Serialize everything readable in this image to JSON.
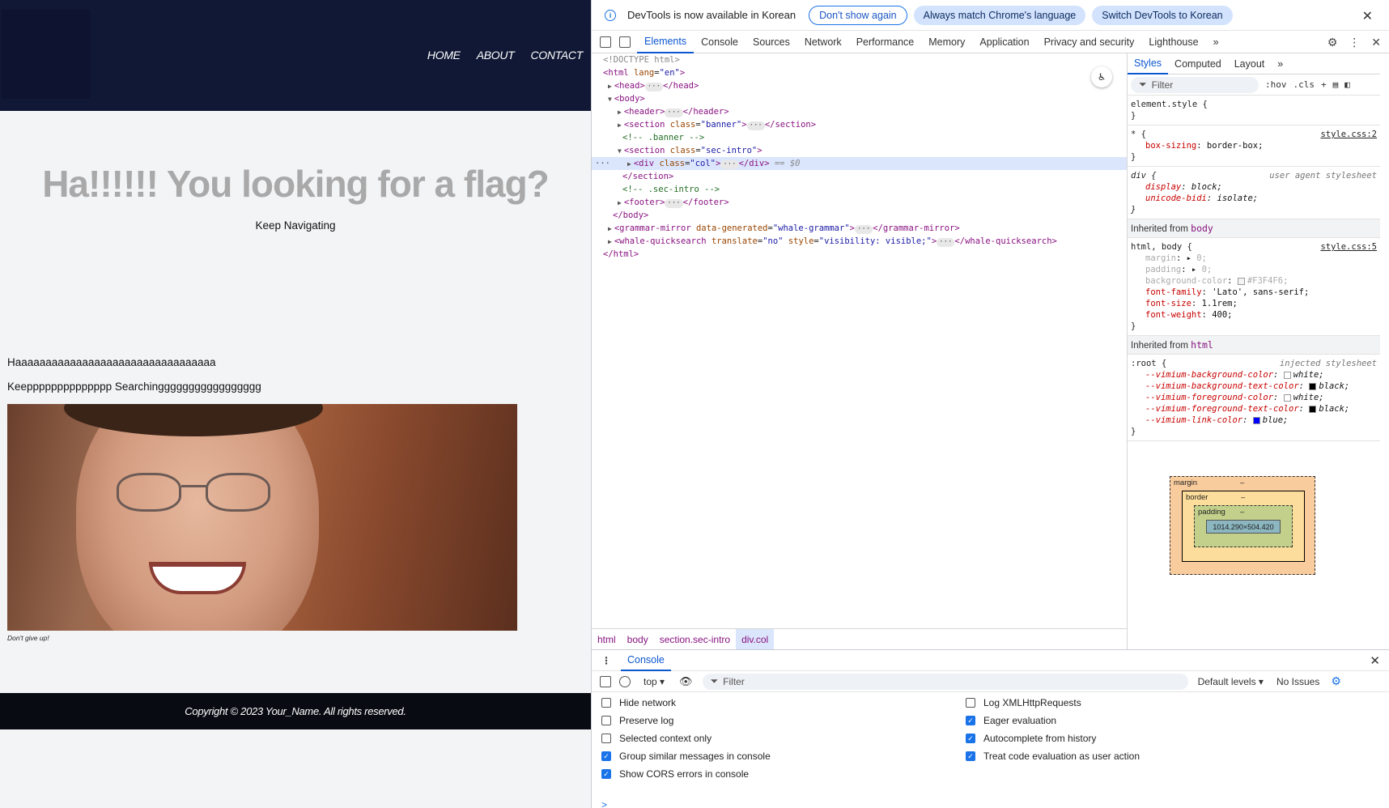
{
  "site": {
    "nav": [
      "HOME",
      "ABOUT",
      "CONTACT"
    ],
    "hero_title": "Ha!!!!!! You looking for a flag?",
    "hero_sub": "Keep Navigating",
    "line1": "Haaaaaaaaaaaaaaaaaaaaaaaaaaaaaaaaa",
    "line2": "Keepppppppppppppp Searchinggggggggggggggggg",
    "caption": "Don't give up!",
    "footer": "Copyright © 2023 Your_Name. All rights reserved."
  },
  "devtools": {
    "notice": {
      "message": "DevTools is now available in Korean",
      "dont_show": "Don't show again",
      "always_match": "Always match Chrome's language",
      "switch": "Switch DevTools to Korean"
    },
    "tabs": [
      "Elements",
      "Console",
      "Sources",
      "Network",
      "Performance",
      "Memory",
      "Application",
      "Privacy and security",
      "Lighthouse"
    ],
    "dom": {
      "doctype": "<!DOCTYPE html>",
      "html_open": "<html",
      "html_lang_attr": "lang",
      "html_lang_val": "\"en\"",
      "head": "<head>",
      "head_close": "</head>",
      "body": "<body>",
      "header": "<header>",
      "header_close": "</header>",
      "section": "<section",
      "class_attr": "class",
      "banner_val": "\"banner\"",
      "section_close": "</section>",
      "comment_banner": "<!-- .banner -->",
      "secintro_val": "\"sec-intro\"",
      "div": "<div",
      "col_val": "\"col\"",
      "div_close": "</div>",
      "sel_marker": "== $0",
      "comment_secintro": "<!-- .sec-intro -->",
      "footer": "<footer>",
      "footer_close": "</footer>",
      "body_close": "</body>",
      "grammar": "<grammar-mirror",
      "grammar_attr": "data-generated",
      "grammar_val": "\"whale-grammar\"",
      "grammar_close": "</grammar-mirror>",
      "whale": "<whale-quicksearch",
      "translate_attr": "translate",
      "translate_val": "\"no\"",
      "style_attr": "style",
      "style_val": "\"visibility: visible;\"",
      "whale_close": "</whale-quicksearch>",
      "html_close": "</html>"
    },
    "breadcrumb": [
      "html",
      "body",
      "section.sec-intro",
      "div.col"
    ],
    "styles_tabs": [
      "Styles",
      "Computed",
      "Layout"
    ],
    "styles_filter": "Filter",
    "hov": ":hov",
    "cls": ".cls",
    "rules": {
      "element_style": "element.style {",
      "star_sel": "* {",
      "star_src": "style.css:2",
      "box_sizing_n": "box-sizing",
      "box_sizing_v": "border-box;",
      "div_sel": "div {",
      "div_src": "user agent stylesheet",
      "display_n": "display",
      "display_v": "block;",
      "unicode_n": "unicode-bidi",
      "unicode_v": "isolate;",
      "inh_body_label": "Inherited from",
      "inh_body_tag": "body",
      "htmlbody_sel": "html, body {",
      "htmlbody_src": "style.css:5",
      "margin_n": "margin",
      "margin_v": "0;",
      "padding_n": "padding",
      "padding_v": "0;",
      "bg_n": "background-color",
      "bg_v": "#F3F4F6;",
      "ff_n": "font-family",
      "ff_v": "'Lato', sans-serif;",
      "fs_n": "font-size",
      "fs_v": "1.1rem;",
      "fw_n": "font-weight",
      "fw_v": "400;",
      "inh_html_tag": "html",
      "root_sel": ":root {",
      "root_src": "injected stylesheet",
      "v1_n": "--vimium-background-color",
      "v1_v": "white;",
      "v2_n": "--vimium-background-text-color",
      "v2_v": "black;",
      "v3_n": "--vimium-foreground-color",
      "v3_v": "white;",
      "v4_n": "--vimium-foreground-text-color",
      "v4_v": "black;",
      "v5_n": "--vimium-link-color",
      "v5_v": "blue;",
      "close": "}"
    },
    "boxmodel": {
      "margin": "margin",
      "border": "border",
      "padding": "padding",
      "dash": "–",
      "content": "1014.290×504.420"
    },
    "console": {
      "tab": "Console",
      "context": "top ▾",
      "filter": "Filter",
      "levels": "Default levels ▾",
      "issues": "No Issues",
      "settings_left": [
        {
          "label": "Hide network",
          "checked": false
        },
        {
          "label": "Preserve log",
          "checked": false
        },
        {
          "label": "Selected context only",
          "checked": false
        },
        {
          "label": "Group similar messages in console",
          "checked": true
        },
        {
          "label": "Show CORS errors in console",
          "checked": true
        }
      ],
      "settings_right": [
        {
          "label": "Log XMLHttpRequests",
          "checked": false
        },
        {
          "label": "Eager evaluation",
          "checked": true
        },
        {
          "label": "Autocomplete from history",
          "checked": true
        },
        {
          "label": "Treat code evaluation as user action",
          "checked": true
        }
      ],
      "prompt": ">"
    },
    "colors": {
      "accent": "#1a73e8",
      "header_bg": "#101835",
      "footer_bg": "#080b12",
      "page_bg": "#F3F4F6"
    }
  }
}
